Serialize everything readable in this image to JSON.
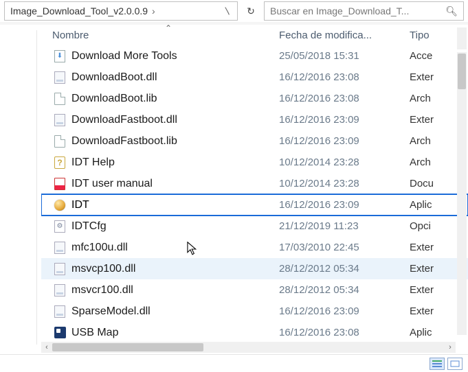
{
  "address": {
    "path": "Image_Download_Tool_v2.0.0.9",
    "crumb_sep": "›"
  },
  "search": {
    "placeholder": "Buscar en Image_Download_T..."
  },
  "columns": {
    "name": "Nombre",
    "date": "Fecha de modifica...",
    "type": "Tipo"
  },
  "files": [
    {
      "icon": "tool",
      "name": "Download More Tools",
      "date": "25/05/2018 15:31",
      "type": "Acce"
    },
    {
      "icon": "dll",
      "name": "DownloadBoot.dll",
      "date": "16/12/2016 23:08",
      "type": "Exter"
    },
    {
      "icon": "file",
      "name": "DownloadBoot.lib",
      "date": "16/12/2016 23:08",
      "type": "Arch"
    },
    {
      "icon": "dll",
      "name": "DownloadFastboot.dll",
      "date": "16/12/2016 23:09",
      "type": "Exter"
    },
    {
      "icon": "file",
      "name": "DownloadFastboot.lib",
      "date": "16/12/2016 23:09",
      "type": "Arch"
    },
    {
      "icon": "help",
      "name": "IDT Help",
      "date": "10/12/2014 23:28",
      "type": "Arch"
    },
    {
      "icon": "pdf",
      "name": "IDT user manual",
      "date": "10/12/2014 23:28",
      "type": "Docu"
    },
    {
      "icon": "exe",
      "name": "IDT",
      "date": "16/12/2016 23:09",
      "type": "Aplic",
      "highlight": true
    },
    {
      "icon": "cfg",
      "name": "IDTCfg",
      "date": "21/12/2019 11:23",
      "type": "Opci"
    },
    {
      "icon": "dll",
      "name": "mfc100u.dll",
      "date": "17/03/2010 22:45",
      "type": "Exter"
    },
    {
      "icon": "dll",
      "name": "msvcp100.dll",
      "date": "28/12/2012 05:34",
      "type": "Exter",
      "hover": true
    },
    {
      "icon": "dll",
      "name": "msvcr100.dll",
      "date": "28/12/2012 05:34",
      "type": "Exter"
    },
    {
      "icon": "dll",
      "name": "SparseModel.dll",
      "date": "16/12/2016 23:09",
      "type": "Exter"
    },
    {
      "icon": "usb",
      "name": "USB Map",
      "date": "16/12/2016 23:08",
      "type": "Aplic"
    }
  ]
}
